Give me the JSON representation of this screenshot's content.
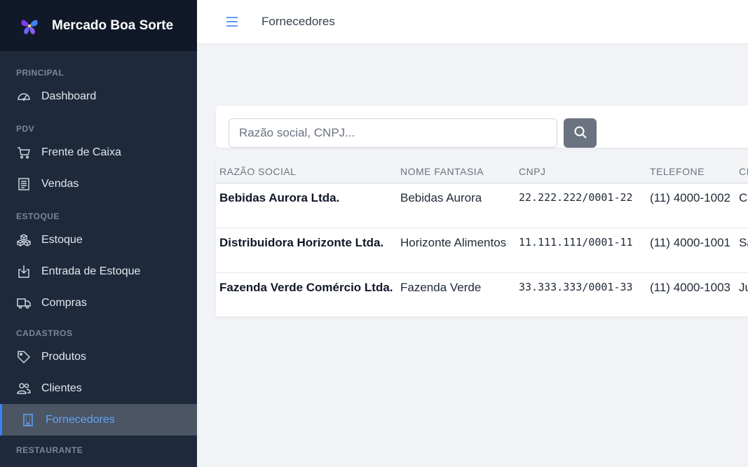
{
  "brand": {
    "name": "Mercado Boa Sorte",
    "logo_icon": "butterfly-logo-icon"
  },
  "sidebar": {
    "sections": {
      "principal": "PRINCIPAL",
      "pdv": "PDV",
      "estoque": "ESTOQUE",
      "cadastros": "CADASTROS",
      "restaurante": "RESTAURANTE"
    },
    "items": {
      "dashboard": {
        "label": "Dashboard",
        "icon": "gauge-icon"
      },
      "frente_caixa": {
        "label": "Frente de Caixa",
        "icon": "cart-icon"
      },
      "vendas": {
        "label": "Vendas",
        "icon": "receipt-icon"
      },
      "estoque": {
        "label": "Estoque",
        "icon": "boxes-icon"
      },
      "entrada_estoque": {
        "label": "Entrada de Estoque",
        "icon": "box-arrow-in-icon"
      },
      "compras": {
        "label": "Compras",
        "icon": "truck-icon"
      },
      "produtos": {
        "label": "Produtos",
        "icon": "tag-icon"
      },
      "clientes": {
        "label": "Clientes",
        "icon": "people-icon"
      },
      "fornecedores": {
        "label": "Fornecedores",
        "icon": "building-icon",
        "active": true
      }
    }
  },
  "topbar": {
    "title": "Fornecedores",
    "menu_icon": "hamburger-icon"
  },
  "search": {
    "placeholder": "Razão social, CNPJ...",
    "value": "",
    "button_icon": "search-icon"
  },
  "table": {
    "headers": {
      "razao": "RAZÃO SOCIAL",
      "fantasia": "NOME FANTASIA",
      "cnpj": "CNPJ",
      "telefone": "TELEFONE",
      "cidade": "CI"
    },
    "rows": [
      {
        "razao": "Bebidas Aurora Ltda.",
        "fantasia": "Bebidas Aurora",
        "cnpj": "22.222.222/0001-22",
        "telefone": "(11) 4000-1002",
        "cidade": "C"
      },
      {
        "razao": "Distribuidora Horizonte Ltda.",
        "fantasia": "Horizonte Alimentos",
        "cnpj": "11.111.111/0001-11",
        "telefone": "(11) 4000-1001",
        "cidade": "Sa"
      },
      {
        "razao": "Fazenda Verde Comércio Ltda.",
        "fantasia": "Fazenda Verde",
        "cnpj": "33.333.333/0001-33",
        "telefone": "(11) 4000-1003",
        "cidade": "Ju"
      }
    ]
  },
  "colors": {
    "sidebar_bg": "#1e293b",
    "brand_bg": "#111827",
    "accent": "#3b82f6",
    "active_bg": "#4b5563"
  }
}
